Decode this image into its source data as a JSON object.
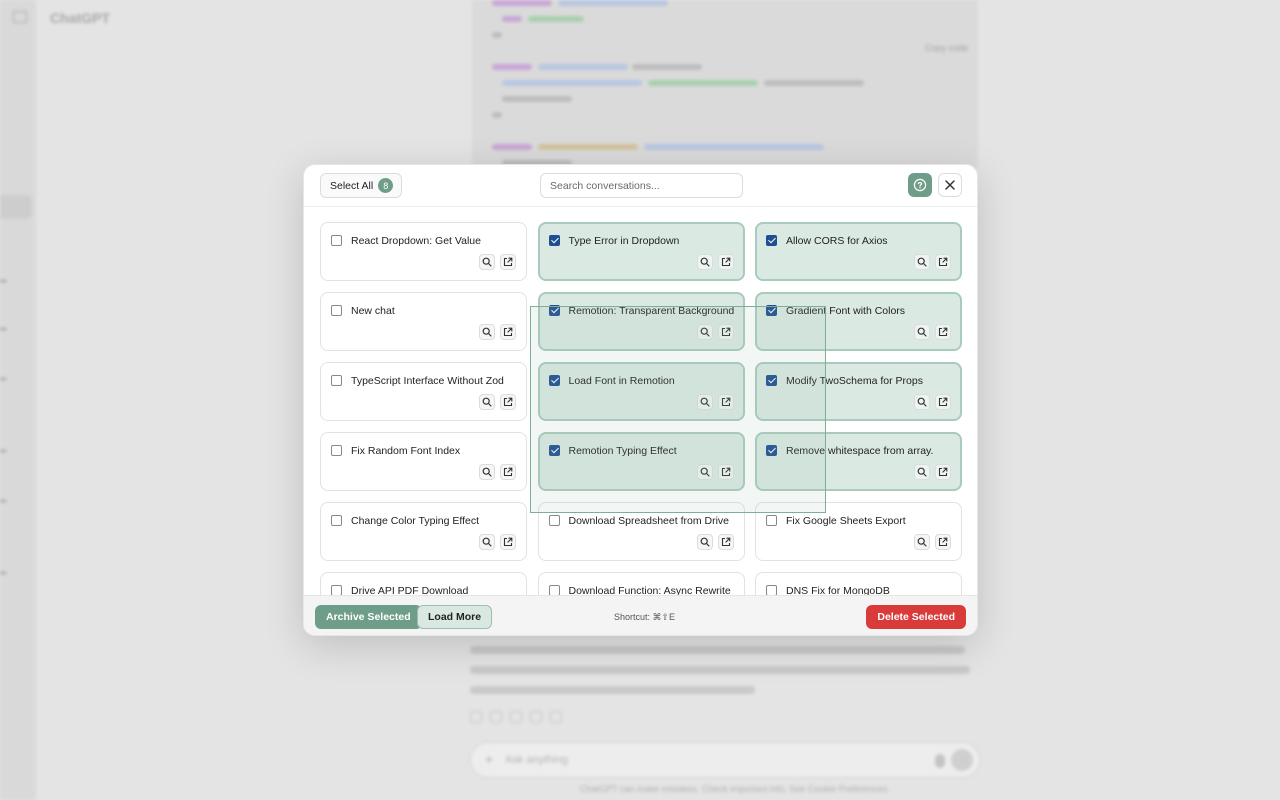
{
  "background": {
    "app_title": "ChatGPT",
    "copy_label": "Copy code",
    "composer_placeholder": "Ask anything",
    "footer_text": "ChatGPT can make mistakes. Check important info. See Cookie Preferences."
  },
  "header": {
    "select_all_label": "Select All",
    "selected_count": "8",
    "search_placeholder": "Search conversations..."
  },
  "conversations": [
    {
      "title": "React Dropdown: Get Value",
      "selected": false
    },
    {
      "title": "Type Error in Dropdown",
      "selected": true
    },
    {
      "title": "Allow CORS for Axios",
      "selected": true
    },
    {
      "title": "New chat",
      "selected": false
    },
    {
      "title": "Remotion: Transparent Background",
      "selected": true
    },
    {
      "title": "Gradient Font with Colors",
      "selected": true
    },
    {
      "title": "TypeScript Interface Without Zod",
      "selected": false
    },
    {
      "title": "Load Font in Remotion",
      "selected": true
    },
    {
      "title": "Modify TwoSchema for Props",
      "selected": true
    },
    {
      "title": "Fix Random Font Index",
      "selected": false
    },
    {
      "title": "Remotion Typing Effect",
      "selected": true
    },
    {
      "title": "Remove whitespace from array.",
      "selected": true
    },
    {
      "title": "Change Color Typing Effect",
      "selected": false
    },
    {
      "title": "Download Spreadsheet from Drive",
      "selected": false
    },
    {
      "title": "Fix Google Sheets Export",
      "selected": false
    },
    {
      "title": "Drive API PDF Download",
      "selected": false
    },
    {
      "title": "Download Function: Async Rewrite",
      "selected": false
    },
    {
      "title": "DNS Fix for MongoDB",
      "selected": false
    }
  ],
  "footer": {
    "archive_label": "Archive Selected",
    "load_more_label": "Load More",
    "shortcut_label": "Shortcut: ⌘⇧E",
    "delete_label": "Delete Selected"
  },
  "colors": {
    "accent": "#6e9e89",
    "selected_bg": "#dbe9e3",
    "checkbox": "#1f4f91",
    "danger": "#d93b3b"
  }
}
